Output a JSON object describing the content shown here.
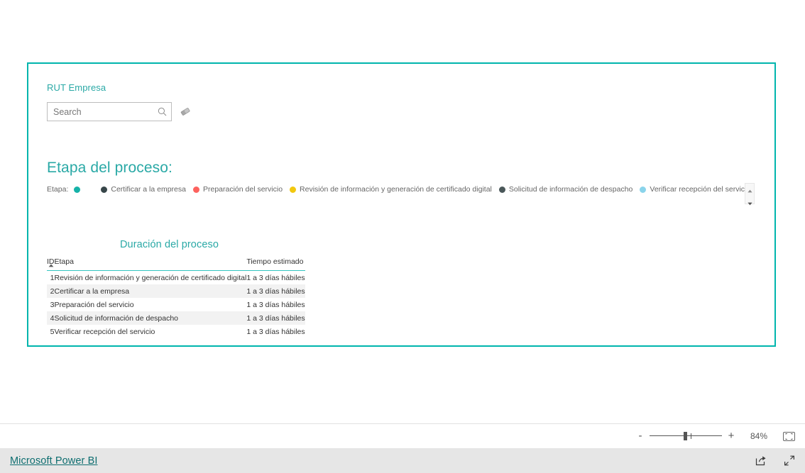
{
  "theme": {
    "accent": "#00b5ad",
    "title_color": "#2aa9a6",
    "brand_link_color": "#0e6e70",
    "canvas_border": "#00b5ad"
  },
  "slicer": {
    "title": "RUT Empresa",
    "search_value": "",
    "search_placeholder": "Search",
    "search_icon": "search-icon",
    "clear_icon": "eraser-icon"
  },
  "etapa_section": {
    "title": "Etapa del proceso:",
    "legend_label": "Etapa:",
    "legend": [
      {
        "label": "",
        "color": "#16b2a8"
      },
      {
        "label": "Certificar a la empresa",
        "color": "#374649"
      },
      {
        "label": "Preparación del servicio",
        "color": "#fd625e"
      },
      {
        "label": "Revisión de información y generación de certificado digital",
        "color": "#f2c80f"
      },
      {
        "label": "Solicitud de información de despacho",
        "color": "#4a5759"
      },
      {
        "label": "Verificar recepción del servicio",
        "color": "#8ad4eb"
      }
    ],
    "scroll_up_icon": "chevron-up-icon",
    "scroll_down_icon": "chevron-down-icon"
  },
  "table_visual": {
    "title": "Duración del proceso",
    "columns": [
      "ID",
      "Etapa",
      "Tiempo estimado"
    ],
    "sort_column": "ID",
    "sort_direction": "ascending",
    "rows": [
      {
        "id": "1",
        "etapa": "Revisión de información y generación de certificado digital",
        "tiempo": "1 a 3 días hábiles"
      },
      {
        "id": "2",
        "etapa": "Certificar a la empresa",
        "tiempo": "1 a 3 días hábiles"
      },
      {
        "id": "3",
        "etapa": "Preparación del servicio",
        "tiempo": "1 a 3 días hábiles"
      },
      {
        "id": "4",
        "etapa": "Solicitud de información de despacho",
        "tiempo": "1 a 3 días hábiles"
      },
      {
        "id": "5",
        "etapa": "Verificar recepción del servicio",
        "tiempo": "1 a 3 días hábiles"
      }
    ]
  },
  "zoom_bar": {
    "minus_label": "-",
    "plus_label": "+",
    "zoom_level": "84%",
    "fit_icon": "fit-to-page-icon"
  },
  "footer": {
    "brand": "Microsoft Power BI",
    "share_icon": "share-icon",
    "fullscreen_icon": "fullscreen-icon"
  }
}
